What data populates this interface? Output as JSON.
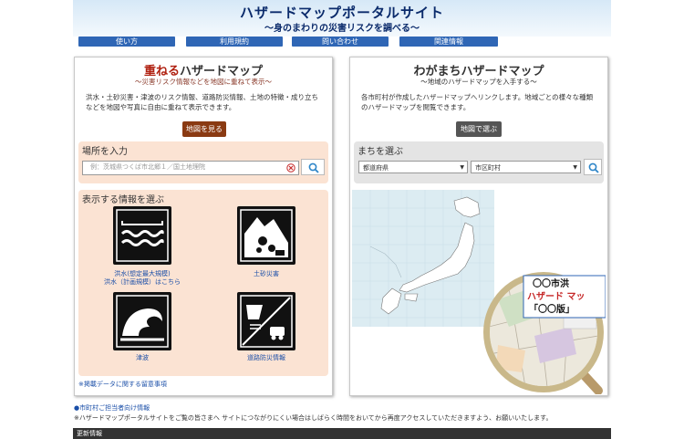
{
  "header": {
    "title": "ハザードマップポータルサイト",
    "subtitle": "〜身のまわりの災害リスクを調べる〜"
  },
  "nav": [
    {
      "label": "使い方"
    },
    {
      "label": "利用規約"
    },
    {
      "label": "問い合わせ"
    },
    {
      "label": "関連情報"
    }
  ],
  "left_panel": {
    "title_prefix": "重ねる",
    "title_suffix": "ハザードマップ",
    "subtitle": "〜災害リスク情報などを地図に重ねて表示〜",
    "description": "洪水・土砂災害・津波のリスク情報、道路防災情報、土地の特徴・成り立ちなどを地図や写真に自由に重ねて表示できます。",
    "button_label": "地図を見る",
    "location_heading": "場所を入力",
    "search_placeholder": "例：茨城県つくば市北郷１／国土地理院",
    "info_heading": "表示する情報を選ぶ",
    "items": [
      {
        "label": "洪水(想定最大規模)\n洪水（計画規模）はこちら",
        "icon": "flood-icon"
      },
      {
        "label": "土砂災害",
        "icon": "landslide-icon"
      },
      {
        "label": "津波",
        "icon": "tsunami-icon"
      },
      {
        "label": "道路防災情報",
        "icon": "road-disaster-icon"
      }
    ],
    "notice_link": "※掲載データに関する留意事項"
  },
  "right_panel": {
    "title_prefix": "わがまち",
    "title_suffix": "ハザードマップ",
    "subtitle": "〜地域のハザードマップを入手する〜",
    "description": "各市町村が作成したハザードマップへリンクします。地域ごとの様々な種類のハザードマップを閲覧できます。",
    "button_label": "地図で選ぶ",
    "town_heading": "まちを選ぶ",
    "prefecture_select": "都道府県",
    "city_select": "市区町村",
    "magnifier_text_line1": "〇〇市洪",
    "magnifier_text_line2": "ハザード マッ",
    "magnifier_text_line3": "「〇〇版」"
  },
  "footer": {
    "municipal_link": "●市町村ご担当者向け情報",
    "notice": "※ハザードマップポータルサイトをご覧の皆さまへ サイトにつながりにくい場合はしばらく時間をおいてから再度アクセスしていただきますよう、お願いいたします。",
    "updates_label": "更新情報"
  },
  "colors": {
    "nav_blue": "#2f66b5",
    "left_button": "#8a3a12",
    "right_button": "#555555",
    "peach": "#fbe3d3",
    "link_blue": "#1b4fa8"
  }
}
